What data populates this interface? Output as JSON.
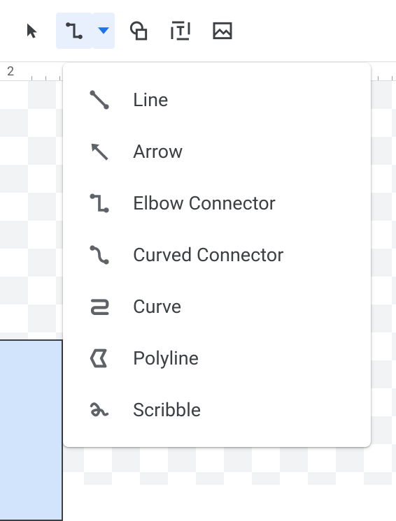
{
  "toolbar": {
    "select": "Select",
    "line": "Line",
    "shape": "Shape",
    "textbox": "Text box",
    "image": "Image"
  },
  "ruler": {
    "label": "2"
  },
  "menu": {
    "items": [
      {
        "label": "Line",
        "icon": "line-icon"
      },
      {
        "label": "Arrow",
        "icon": "arrow-icon"
      },
      {
        "label": "Elbow Connector",
        "icon": "elbow-connector-icon"
      },
      {
        "label": "Curved Connector",
        "icon": "curved-connector-icon"
      },
      {
        "label": "Curve",
        "icon": "curve-icon"
      },
      {
        "label": "Polyline",
        "icon": "polyline-icon"
      },
      {
        "label": "Scribble",
        "icon": "scribble-icon"
      }
    ]
  }
}
